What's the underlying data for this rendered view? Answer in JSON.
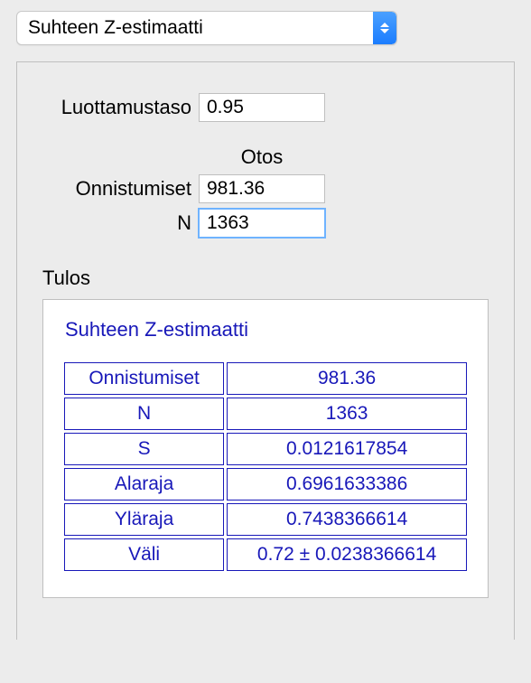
{
  "dropdown": {
    "selected": "Suhteen Z-estimaatti"
  },
  "fields": {
    "confidence": {
      "label": "Luottamustaso",
      "value": "0.95"
    },
    "sample_header": "Otos",
    "successes": {
      "label": "Onnistumiset",
      "value": "981.36"
    },
    "n": {
      "label": "N",
      "value": "1363"
    }
  },
  "result": {
    "section_label": "Tulos",
    "title": "Suhteen Z-estimaatti",
    "rows": [
      {
        "k": "Onnistumiset",
        "v": "981.36"
      },
      {
        "k": "N",
        "v": "1363"
      },
      {
        "k": "S",
        "v": "0.0121617854"
      },
      {
        "k": "Alaraja",
        "v": "0.6961633386"
      },
      {
        "k": "Yläraja",
        "v": "0.7438366614"
      },
      {
        "k": "Väli",
        "v": "0.72 ± 0.0238366614"
      }
    ]
  }
}
